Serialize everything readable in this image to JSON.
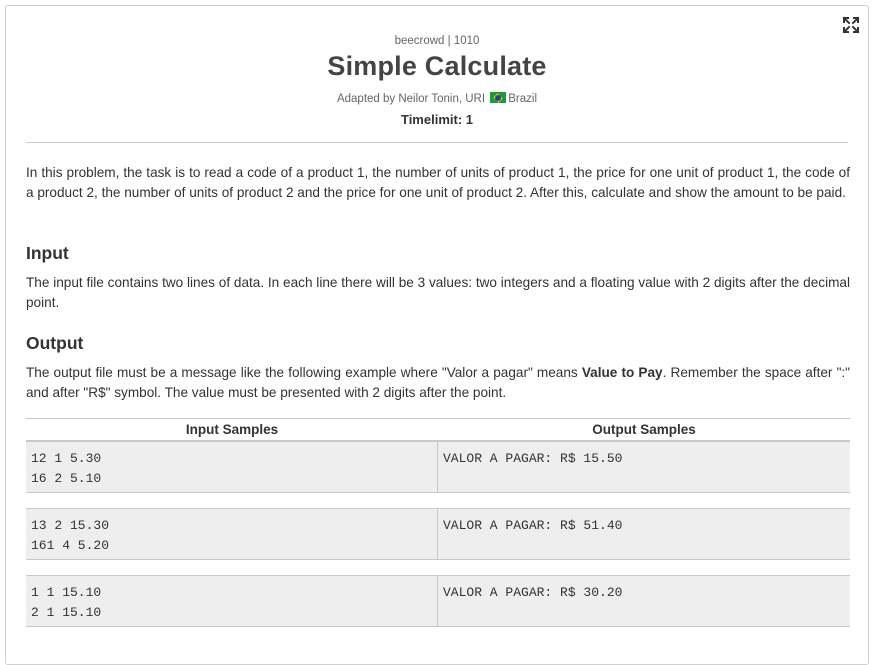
{
  "header": {
    "breadcrumb": "beecrowd | 1010",
    "title": "Simple Calculate",
    "adapted_prefix": "Adapted by Neilor Tonin, URI",
    "country": "Brazil",
    "timelimit": "Timelimit: 1"
  },
  "description": "In this problem, the task is to read a code of a product 1, the number of units of product 1, the price for one unit of product 1, the code of a product 2, the number of units of product 2 and the price for one unit of product 2. After this, calculate and show the amount to be paid.",
  "input": {
    "heading": "Input",
    "text": "The input file contains two lines of data. In each line there will be 3 values: two integers and a floating value with 2 digits after the decimal point."
  },
  "output": {
    "heading": "Output",
    "text_before": "The output file must be a message like the following example where \"Valor a pagar\" means ",
    "text_bold": "Value to Pay",
    "text_after": ". Remember the space after \":\" and after \"R$\" symbol. The value must be presented with 2 digits after the point."
  },
  "samples": {
    "input_header": "Input Samples",
    "output_header": "Output Samples",
    "rows": [
      {
        "input": "12 1 5.30\n16 2 5.10",
        "output": "VALOR A PAGAR: R$ 15.50"
      },
      {
        "input": "13 2 15.30\n161 4 5.20",
        "output": "VALOR A PAGAR: R$ 51.40"
      },
      {
        "input": "1 1 15.10\n2 1 15.10",
        "output": "VALOR A PAGAR: R$ 30.20"
      }
    ]
  },
  "icons": {
    "expand": "expand-icon",
    "flag": "brazil-flag-icon"
  }
}
